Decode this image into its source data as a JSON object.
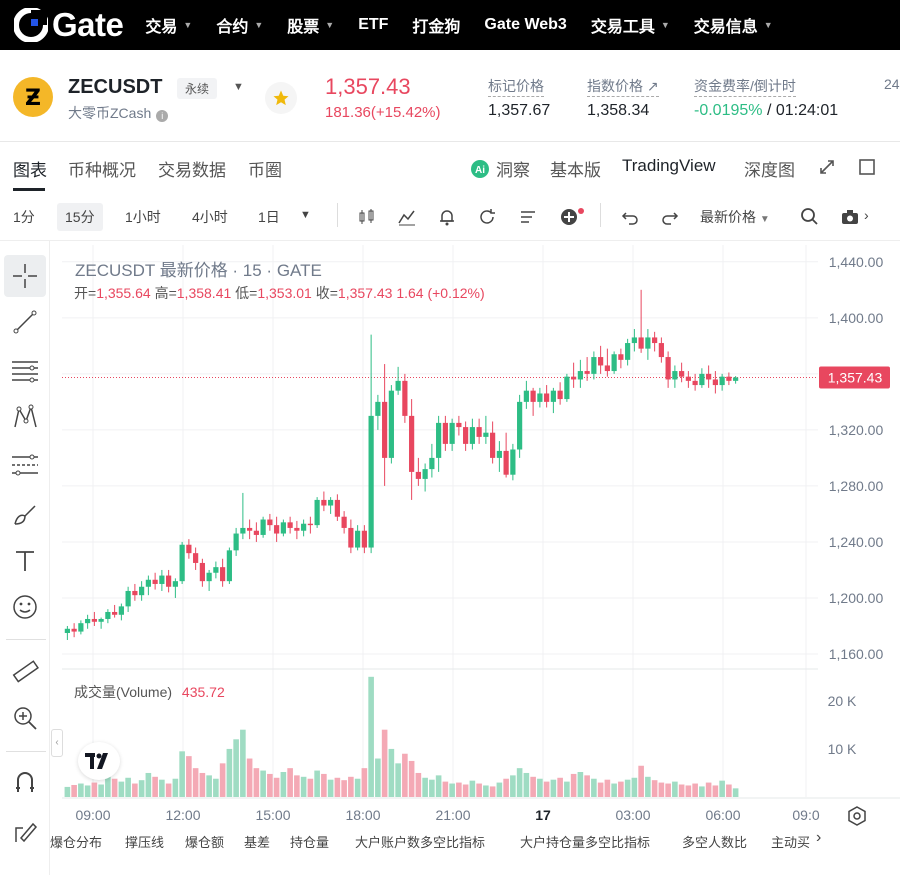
{
  "topnav": {
    "logo_text": "Gate",
    "items": [
      {
        "label": "交易",
        "caret": true
      },
      {
        "label": "合约",
        "caret": true
      },
      {
        "label": "股票",
        "caret": true
      },
      {
        "label": "ETF",
        "caret": false
      },
      {
        "label": "打金狗",
        "caret": false
      },
      {
        "label": "Gate Web3",
        "caret": false
      },
      {
        "label": "交易工具",
        "caret": true
      },
      {
        "label": "交易信息",
        "caret": true
      }
    ]
  },
  "header": {
    "symbol": "ZECUSDT",
    "contract_type": "永续",
    "coin_name": "大零币ZCash",
    "last_price": "1,357.43",
    "change": "181.36(+15.42%)",
    "mark_price_label": "标记价格",
    "mark_price": "1,357.67",
    "index_price_label": "指数价格 ↗",
    "index_price": "1,358.34",
    "funding_label": "资金费率/倒计时",
    "funding_rate": "-0.0195%",
    "countdown": " / 01:24:01",
    "vol_label_partial": "24"
  },
  "tabs": {
    "left": [
      "图表",
      "币种概况",
      "交易数据",
      "币圈"
    ],
    "insight": "洞察",
    "basic": "基本版",
    "tradingview": "TradingView",
    "depth": "深度图"
  },
  "toolbar": {
    "intervals": [
      "1分",
      "15分",
      "1小时",
      "4小时",
      "1日"
    ],
    "selected_interval": "15分",
    "price_type": "最新价格"
  },
  "chart_data": {
    "type": "candlestick",
    "title": "ZECUSDT 最新价格 · 15 · GATE",
    "ohlc_label": {
      "open_label": "开=",
      "open": "1,355.64",
      "high_label": "高=",
      "high": "1,358.41",
      "low_label": "低=",
      "low": "1,353.01",
      "close_label": "收=",
      "close": "1,357.43",
      "change": "1.64 (+0.12%)"
    },
    "volume_label": "成交量(Volume)",
    "volume_value": "435.72",
    "y_ticks": [
      "1,440.00",
      "1,400.00",
      "1,360.00",
      "1,320.00",
      "1,280.00",
      "1,240.00",
      "1,200.00",
      "1,160.00"
    ],
    "y_tick_values": [
      1440,
      1400,
      1360,
      1320,
      1280,
      1240,
      1200,
      1160
    ],
    "ylim": [
      1150,
      1452
    ],
    "current_price_label": "1,357.43",
    "current_price": 1357.43,
    "volume_ticks": [
      "20 K",
      "10 K"
    ],
    "volume_tick_values": [
      20000,
      10000
    ],
    "x_ticks": [
      "09:00",
      "12:00",
      "15:00",
      "18:00",
      "21:00",
      "17",
      "03:00",
      "06:00",
      "09:0"
    ],
    "candles": [
      [
        1175,
        1180,
        1170,
        1178
      ],
      [
        1178,
        1182,
        1172,
        1176
      ],
      [
        1176,
        1184,
        1174,
        1182
      ],
      [
        1182,
        1188,
        1178,
        1185
      ],
      [
        1185,
        1190,
        1180,
        1183
      ],
      [
        1183,
        1186,
        1178,
        1185
      ],
      [
        1185,
        1192,
        1182,
        1190
      ],
      [
        1190,
        1195,
        1186,
        1188
      ],
      [
        1188,
        1196,
        1184,
        1194
      ],
      [
        1194,
        1208,
        1190,
        1205
      ],
      [
        1205,
        1210,
        1198,
        1202
      ],
      [
        1202,
        1212,
        1198,
        1208
      ],
      [
        1208,
        1216,
        1202,
        1213
      ],
      [
        1213,
        1218,
        1206,
        1210
      ],
      [
        1210,
        1220,
        1205,
        1216
      ],
      [
        1216,
        1220,
        1204,
        1208
      ],
      [
        1208,
        1214,
        1200,
        1212
      ],
      [
        1212,
        1240,
        1210,
        1238
      ],
      [
        1238,
        1242,
        1228,
        1232
      ],
      [
        1232,
        1236,
        1220,
        1225
      ],
      [
        1225,
        1228,
        1208,
        1212
      ],
      [
        1212,
        1220,
        1205,
        1218
      ],
      [
        1218,
        1226,
        1214,
        1222
      ],
      [
        1222,
        1228,
        1208,
        1212
      ],
      [
        1212,
        1236,
        1210,
        1234
      ],
      [
        1234,
        1250,
        1230,
        1246
      ],
      [
        1246,
        1275,
        1242,
        1250
      ],
      [
        1250,
        1256,
        1242,
        1248
      ],
      [
        1248,
        1254,
        1240,
        1245
      ],
      [
        1245,
        1258,
        1243,
        1256
      ],
      [
        1256,
        1260,
        1248,
        1252
      ],
      [
        1252,
        1258,
        1240,
        1246
      ],
      [
        1246,
        1256,
        1244,
        1254
      ],
      [
        1254,
        1258,
        1246,
        1250
      ],
      [
        1250,
        1255,
        1242,
        1248
      ],
      [
        1248,
        1256,
        1244,
        1253
      ],
      [
        1253,
        1258,
        1246,
        1252
      ],
      [
        1252,
        1272,
        1250,
        1270
      ],
      [
        1270,
        1276,
        1262,
        1266
      ],
      [
        1266,
        1272,
        1260,
        1270
      ],
      [
        1270,
        1274,
        1255,
        1258
      ],
      [
        1258,
        1262,
        1246,
        1250
      ],
      [
        1250,
        1256,
        1232,
        1236
      ],
      [
        1236,
        1252,
        1234,
        1248
      ],
      [
        1248,
        1252,
        1232,
        1236
      ],
      [
        1236,
        1388,
        1232,
        1330
      ],
      [
        1330,
        1345,
        1320,
        1340
      ],
      [
        1340,
        1367,
        1280,
        1300
      ],
      [
        1300,
        1352,
        1296,
        1348
      ],
      [
        1348,
        1365,
        1345,
        1355
      ],
      [
        1355,
        1360,
        1325,
        1330
      ],
      [
        1330,
        1342,
        1270,
        1290
      ],
      [
        1290,
        1300,
        1280,
        1285
      ],
      [
        1285,
        1296,
        1276,
        1292
      ],
      [
        1292,
        1310,
        1286,
        1300
      ],
      [
        1300,
        1330,
        1290,
        1325
      ],
      [
        1325,
        1330,
        1305,
        1310
      ],
      [
        1310,
        1328,
        1305,
        1325
      ],
      [
        1325,
        1330,
        1316,
        1322
      ],
      [
        1322,
        1326,
        1305,
        1310
      ],
      [
        1310,
        1328,
        1306,
        1322
      ],
      [
        1322,
        1328,
        1310,
        1315
      ],
      [
        1315,
        1330,
        1310,
        1318
      ],
      [
        1318,
        1326,
        1296,
        1300
      ],
      [
        1300,
        1312,
        1290,
        1305
      ],
      [
        1305,
        1318,
        1286,
        1288
      ],
      [
        1288,
        1310,
        1284,
        1306
      ],
      [
        1306,
        1345,
        1300,
        1340
      ],
      [
        1340,
        1355,
        1335,
        1348
      ],
      [
        1348,
        1350,
        1330,
        1340
      ],
      [
        1340,
        1350,
        1336,
        1346
      ],
      [
        1346,
        1352,
        1336,
        1340
      ],
      [
        1340,
        1350,
        1332,
        1348
      ],
      [
        1348,
        1354,
        1338,
        1342
      ],
      [
        1342,
        1360,
        1340,
        1358
      ],
      [
        1358,
        1368,
        1350,
        1356
      ],
      [
        1356,
        1370,
        1350,
        1362
      ],
      [
        1362,
        1372,
        1355,
        1360
      ],
      [
        1360,
        1376,
        1356,
        1372
      ],
      [
        1372,
        1380,
        1360,
        1366
      ],
      [
        1366,
        1378,
        1358,
        1362
      ],
      [
        1362,
        1376,
        1360,
        1374
      ],
      [
        1374,
        1378,
        1364,
        1370
      ],
      [
        1370,
        1385,
        1366,
        1382
      ],
      [
        1382,
        1392,
        1376,
        1386
      ],
      [
        1386,
        1420,
        1375,
        1378
      ],
      [
        1378,
        1392,
        1370,
        1386
      ],
      [
        1386,
        1390,
        1376,
        1382
      ],
      [
        1382,
        1386,
        1368,
        1372
      ],
      [
        1372,
        1376,
        1350,
        1356
      ],
      [
        1356,
        1366,
        1350,
        1362
      ],
      [
        1362,
        1368,
        1354,
        1358
      ],
      [
        1358,
        1362,
        1350,
        1355
      ],
      [
        1355,
        1360,
        1348,
        1352
      ],
      [
        1352,
        1364,
        1350,
        1360
      ],
      [
        1360,
        1366,
        1350,
        1356
      ],
      [
        1356,
        1362,
        1346,
        1352
      ],
      [
        1352,
        1360,
        1348,
        1358
      ],
      [
        1358,
        1361,
        1352,
        1355
      ],
      [
        1355,
        1358.41,
        1353.01,
        1357.43
      ]
    ],
    "volumes": [
      2.1,
      2.5,
      2.8,
      2.4,
      3.0,
      2.6,
      4.5,
      3.8,
      3.2,
      4.0,
      2.8,
      3.5,
      5.0,
      4.2,
      3.6,
      2.8,
      3.8,
      9.5,
      8.5,
      6.0,
      5.0,
      4.5,
      3.8,
      7.0,
      10.0,
      12.0,
      14.0,
      8.0,
      6.0,
      5.5,
      4.8,
      4.0,
      5.2,
      6.0,
      4.5,
      4.2,
      3.8,
      5.5,
      4.8,
      3.6,
      4.0,
      3.5,
      4.2,
      3.8,
      6.0,
      25.0,
      8.0,
      14.0,
      10.0,
      7.0,
      9.0,
      7.5,
      5.0,
      4.0,
      3.6,
      4.5,
      3.2,
      2.8,
      3.0,
      2.6,
      3.4,
      2.8,
      2.4,
      2.2,
      3.0,
      3.8,
      4.5,
      6.0,
      5.0,
      4.2,
      3.8,
      3.2,
      3.6,
      4.0,
      3.2,
      4.8,
      5.2,
      4.5,
      3.8,
      3.0,
      3.6,
      2.8,
      3.2,
      3.6,
      4.0,
      6.5,
      4.2,
      3.5,
      3.0,
      2.8,
      3.2,
      2.6,
      2.4,
      2.8,
      2.2,
      3.0,
      2.4,
      3.4,
      2.6,
      1.8
    ]
  },
  "bottombar": {
    "items": [
      "爆仓分布",
      "撑压线",
      "爆仓额",
      "基差",
      "持仓量",
      "大户账户数多空比指标",
      "大户持仓量多空比指标",
      "多空人数比",
      "主动买"
    ]
  }
}
